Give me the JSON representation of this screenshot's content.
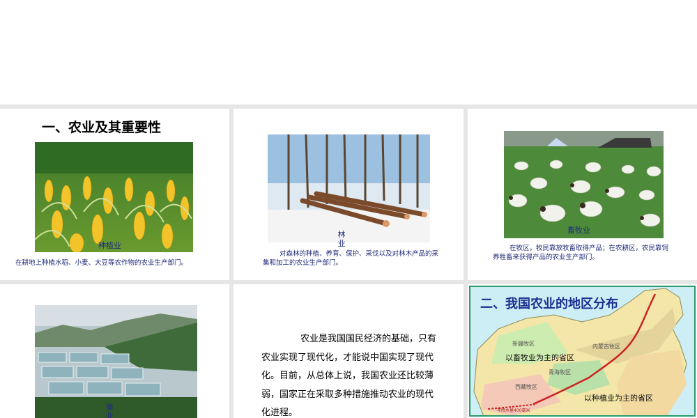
{
  "slide1": {
    "title": "一、农业及其重要性",
    "label": "种植业",
    "caption": "在耕地上种植水稻、小麦、大豆等农作物的农业生产部门。"
  },
  "slide2": {
    "label": "林业",
    "caption": "对森林的种植、养育、保护、采伐以及对林木产品的采集和加工的农业生产部门。"
  },
  "slide3": {
    "label": "畜牧业",
    "caption": "在牧区，牧民靠放牧畜取得产品；在农耕区，农民靠饲养牲畜来获得产品的农业生产部门。"
  },
  "slide4": {
    "label": "渔业"
  },
  "slide5": {
    "paragraph": "农业是我国国民经济的基础，只有农业实现了现代化，才能说中国实现了现代化。目前，从总体上说，我国农业还比较薄弱，国家正在采取多种措施推动农业的现代化进程。"
  },
  "slide6": {
    "title": "二、我国农业的地区分布",
    "pastoral_label": "以畜牧业为主的省区",
    "farming_label": "以种植业为主的省区",
    "regions": [
      "新疆牧区",
      "青海牧区",
      "西藏牧区",
      "内蒙古牧区"
    ],
    "rain_line_label": "年降水量400毫米"
  },
  "colors": {
    "caption": "#1f2a7a",
    "map_border": "#2b9a6a",
    "map_title": "#1b2f8f",
    "boundary_line": "#cc2222"
  }
}
